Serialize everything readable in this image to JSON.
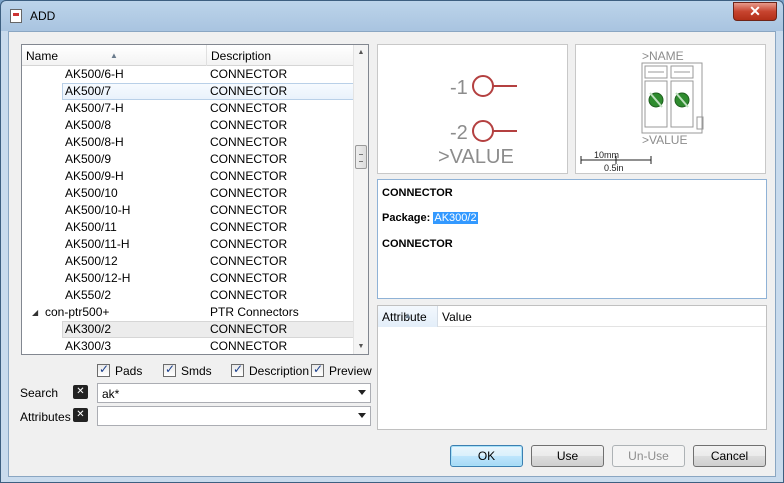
{
  "window": {
    "title": "ADD",
    "close_glyph": "✕"
  },
  "tree": {
    "columns": {
      "name": "Name",
      "description": "Description"
    },
    "rows": [
      {
        "name": "AK500/6-H",
        "desc": "CONNECTOR",
        "style": "normal"
      },
      {
        "name": "AK500/7",
        "desc": "CONNECTOR",
        "style": "sel-light"
      },
      {
        "name": "AK500/7-H",
        "desc": "CONNECTOR",
        "style": "normal"
      },
      {
        "name": "AK500/8",
        "desc": "CONNECTOR",
        "style": "normal"
      },
      {
        "name": "AK500/8-H",
        "desc": "CONNECTOR",
        "style": "normal"
      },
      {
        "name": "AK500/9",
        "desc": "CONNECTOR",
        "style": "normal"
      },
      {
        "name": "AK500/9-H",
        "desc": "CONNECTOR",
        "style": "normal"
      },
      {
        "name": "AK500/10",
        "desc": "CONNECTOR",
        "style": "normal"
      },
      {
        "name": "AK500/10-H",
        "desc": "CONNECTOR",
        "style": "normal"
      },
      {
        "name": "AK500/11",
        "desc": "CONNECTOR",
        "style": "normal"
      },
      {
        "name": "AK500/11-H",
        "desc": "CONNECTOR",
        "style": "normal"
      },
      {
        "name": "AK500/12",
        "desc": "CONNECTOR",
        "style": "normal"
      },
      {
        "name": "AK500/12-H",
        "desc": "CONNECTOR",
        "style": "normal"
      },
      {
        "name": "AK550/2",
        "desc": "CONNECTOR",
        "style": "normal"
      },
      {
        "name": "con-ptr500+",
        "desc": "PTR Connectors",
        "style": "group"
      },
      {
        "name": "AK300/2",
        "desc": "CONNECTOR",
        "style": "sel-gray"
      },
      {
        "name": "AK300/3",
        "desc": "CONNECTOR",
        "style": "normal"
      }
    ]
  },
  "options": {
    "pads": {
      "label": "Pads",
      "checked": true
    },
    "smds": {
      "label": "Smds",
      "checked": true
    },
    "description": {
      "label": "Description",
      "checked": true
    },
    "preview": {
      "label": "Preview",
      "checked": true
    }
  },
  "search": {
    "label": "Search",
    "value": "ak*"
  },
  "attributes_filter": {
    "label": "Attributes",
    "value": ""
  },
  "symbol_preview": {
    "pin1": "-1",
    "pin2": "-2",
    "value_text": ">VALUE"
  },
  "package_preview": {
    "name_text": ">NAME",
    "value_text": ">VALUE",
    "scale_mm": "10mm",
    "scale_in": "0.5in"
  },
  "info": {
    "title": "CONNECTOR",
    "package_label": "Package:",
    "package_name": "AK300/2",
    "description": "CONNECTOR"
  },
  "attributes_table": {
    "col_attribute": "Attribute",
    "col_value": "Value"
  },
  "buttons": {
    "ok": "OK",
    "use": "Use",
    "unuse": "Un-Use",
    "cancel": "Cancel"
  },
  "colors": {
    "selection": "#3399ff",
    "pin_circle": "#b44040",
    "pad_green": "#2e8b2e"
  }
}
